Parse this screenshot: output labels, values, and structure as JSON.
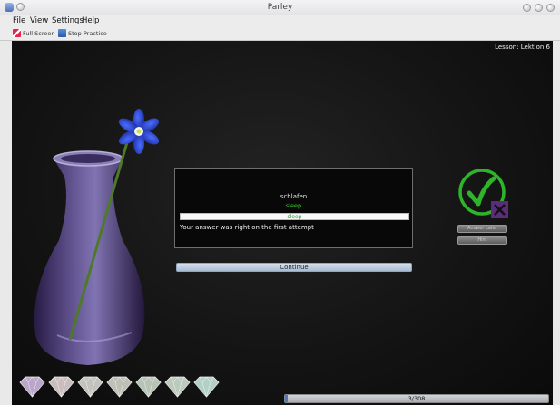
{
  "window": {
    "title": "Parley"
  },
  "menu": [
    "File",
    "View",
    "Settings",
    "Help"
  ],
  "toolbar": {
    "full_screen": "Full Screen",
    "stop_practice": "Stop Practice"
  },
  "lesson_label": "Lesson: Lektion 6",
  "question": {
    "word": "schlafen",
    "correct_answer": "sleep",
    "user_answer": "sleep",
    "feedback": "Your answer was right on the first attempt"
  },
  "continue_label": "Continue",
  "side_buttons": {
    "answer_later": "Answer Later",
    "hint": "Hint"
  },
  "progress": {
    "label": "3/308",
    "fraction": 0.0097
  },
  "gem_colors": [
    "#b9a6c9",
    "#c9bebd",
    "#c3c2bd",
    "#bdc0b5",
    "#b7c3b5",
    "#bcc9bd",
    "#b3d0c4"
  ],
  "colors": {
    "accent_green": "#2fb32a",
    "accent_purple": "#5a2d7a"
  }
}
